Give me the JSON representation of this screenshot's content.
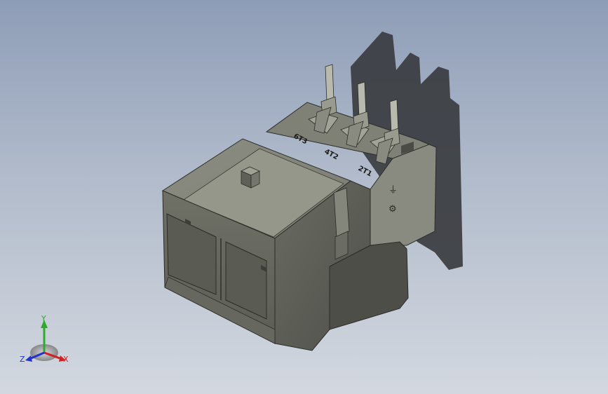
{
  "viewport": {
    "background_top": "#8e9db7",
    "background_bottom": "#d3d8e0"
  },
  "model": {
    "body_color": "#75766c",
    "shade_color": "#55564e",
    "terminal_labels": [
      "6T3",
      "4T2",
      "2T1"
    ],
    "side_symbols": [
      "⏚",
      "⚙"
    ]
  },
  "triad": {
    "x_label": "X",
    "y_label": "Y",
    "z_label": "Z",
    "x_color": "#d42020",
    "y_color": "#2eaa2e",
    "z_color": "#2233cc"
  }
}
